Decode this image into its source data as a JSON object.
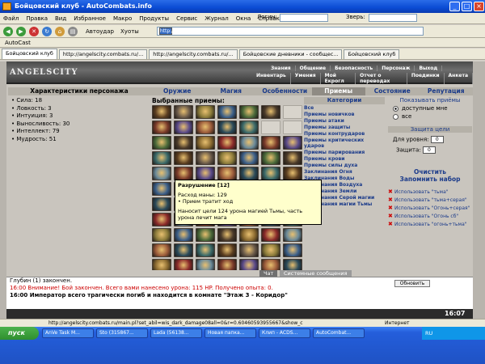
{
  "window": {
    "title": "Бойцовский клуб - AutoCombats.info"
  },
  "menu": [
    "Файл",
    "Правка",
    "Вид",
    "Избранное",
    "Макро",
    "Продукты",
    "Сервис",
    "Журнал",
    "Окна",
    "Справка"
  ],
  "toolbar": {
    "login_label": "Логин:",
    "beast_label": "Зверь:",
    "autoblow": "Автоудар",
    "kicks": "Хуоты",
    "address": "http://192.168.0.18/"
  },
  "toolbar2": {
    "label": "AutoCast"
  },
  "tabs": [
    "Бойцовский клуб",
    "http://angelscity.combats.ru/...",
    "http://angelscity.combats.ru/...",
    "Бойцовские дневники - сообщес...",
    "Бойцовский клуб"
  ],
  "game": {
    "logo": "ANGELSCITY",
    "nav1": [
      "Знания",
      "Общение",
      "Безопасность",
      "Персонаж",
      "Выход"
    ],
    "nav2": [
      "Инвентарь",
      "Умения",
      "Мой Екрогл",
      "Отчет о переводах",
      "Поединки",
      "Анкета"
    ],
    "char_header": "Характеристики персонажа",
    "categories": [
      "Оружие",
      "Магия",
      "Особенности",
      "Приемы",
      "Состояние",
      "Репутация"
    ],
    "stats": [
      "Сила: 18",
      "Ловкость: 3",
      "Интуиция: 3",
      "Выносливость: 30",
      "Интеллект: 79",
      "Мудрость: 51"
    ],
    "selected_header": "Выбранные приемы:",
    "tooltip": {
      "title": "Разрушение [12]",
      "lines": [
        "Расход маны: 129",
        "• Прием тратит ход",
        "Наносит цели 124 урона магией Тьмы, часть урона лечит мага"
      ]
    },
    "cat_header": "Категории",
    "cat_items": [
      "Все",
      "Приемы новичков",
      "Приемы атаки",
      "Приемы защиты",
      "Приемы контрударов",
      "Приемы критических ударов",
      "Приемы парирования",
      "Приемы крови",
      "Приемы силы духа",
      "Заклинания Огня",
      "Заклинания Воды",
      "Заклинания Воздуха",
      "Заклинания Земли",
      "Заклинания Серой магии",
      "Заклинания магии Тьмы"
    ],
    "show_label": "Показывать приёмы",
    "show_opts": [
      "доступные мне",
      "все"
    ],
    "protect_label": "Защита цели",
    "level_label": "Для уровня:",
    "level_val": "0",
    "protect_field": "Защита:",
    "protect_val": "0",
    "clear": "Очистить",
    "remember": "Запомнить набор",
    "uses": [
      "Использовать \"тьма\"",
      "Использовать \"тьма+серая\"",
      "Использовать \"Огонь+серая\"",
      "Использовать \"Огонь сб\"",
      "Использовать \"огонь+тьма\""
    ],
    "chat_tab": "Чат",
    "sys_tab": "Системные сообщения",
    "renew": "Обновить",
    "chat_lines": [
      "Глубин (1) закончен.",
      "16:00 Внимание! Бой закончен. Всего вами нанесено урона: 115 HP. Получено опыта: 0.",
      "16:00 Император всего трагически погиб и находится в комнате \"Этаж 3 - Коридор\""
    ],
    "clock": "16:07"
  },
  "status": "http://angelscity.combats.ru/main.pl?set_abil=wis_dark_damage08all=0&r=0.60460593955667&show_c",
  "taskbar": {
    "start": "пуск",
    "items": [
      "AnVe Task M...",
      "Sto (315867...",
      "Lada (56138...",
      "Новая папка...",
      "Клип - ACDS...",
      "AutoCombat..."
    ],
    "lang": "RU",
    "net": "Интернет"
  },
  "colors": {
    "accent": "#1a3a8a",
    "tooltip_bg": "#ffffcc"
  },
  "icon_colors": [
    "#5a3d20",
    "#3b5f8a",
    "#8a6a30",
    "#7a3a2a",
    "#2a4a5a",
    "#6a5a4a",
    "#4a6a3a",
    "#8a2a2a",
    "#5a4a8a",
    "#3a6a6a",
    "#8a7a3a",
    "#4a3a2a",
    "#6a8a9a",
    "#9a5a3a"
  ]
}
